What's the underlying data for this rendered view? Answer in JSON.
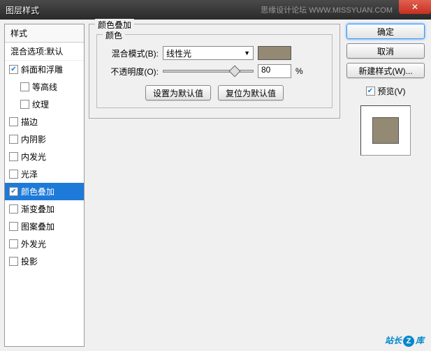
{
  "title": "图层样式",
  "watermark_top": "思缘设计论坛 WWW.MISSYUAN.COM",
  "watermark_bottom_1": "站长",
  "watermark_bottom_2": "库",
  "left": {
    "header": "样式",
    "sub": "混合选项:默认",
    "items": [
      {
        "label": "斜面和浮雕",
        "checked": true,
        "indent": false
      },
      {
        "label": "等高线",
        "checked": false,
        "indent": true
      },
      {
        "label": "纹理",
        "checked": false,
        "indent": true
      },
      {
        "label": "描边",
        "checked": false,
        "indent": false
      },
      {
        "label": "内阴影",
        "checked": false,
        "indent": false
      },
      {
        "label": "内发光",
        "checked": false,
        "indent": false
      },
      {
        "label": "光泽",
        "checked": false,
        "indent": false
      },
      {
        "label": "颜色叠加",
        "checked": true,
        "indent": false,
        "selected": true
      },
      {
        "label": "渐变叠加",
        "checked": false,
        "indent": false
      },
      {
        "label": "图案叠加",
        "checked": false,
        "indent": false
      },
      {
        "label": "外发光",
        "checked": false,
        "indent": false
      },
      {
        "label": "投影",
        "checked": false,
        "indent": false
      }
    ]
  },
  "center": {
    "group_title": "颜色叠加",
    "inner_title": "颜色",
    "blend_label": "混合模式(B):",
    "blend_value": "线性光",
    "opacity_label": "不透明度(O):",
    "opacity_value": "80",
    "opacity_unit": "%",
    "swatch_color": "#948a74",
    "btn_default": "设置为默认值",
    "btn_reset": "复位为默认值"
  },
  "right": {
    "ok": "确定",
    "cancel": "取消",
    "new_style": "新建样式(W)...",
    "preview_label": "预览(V)",
    "preview_checked": true
  }
}
